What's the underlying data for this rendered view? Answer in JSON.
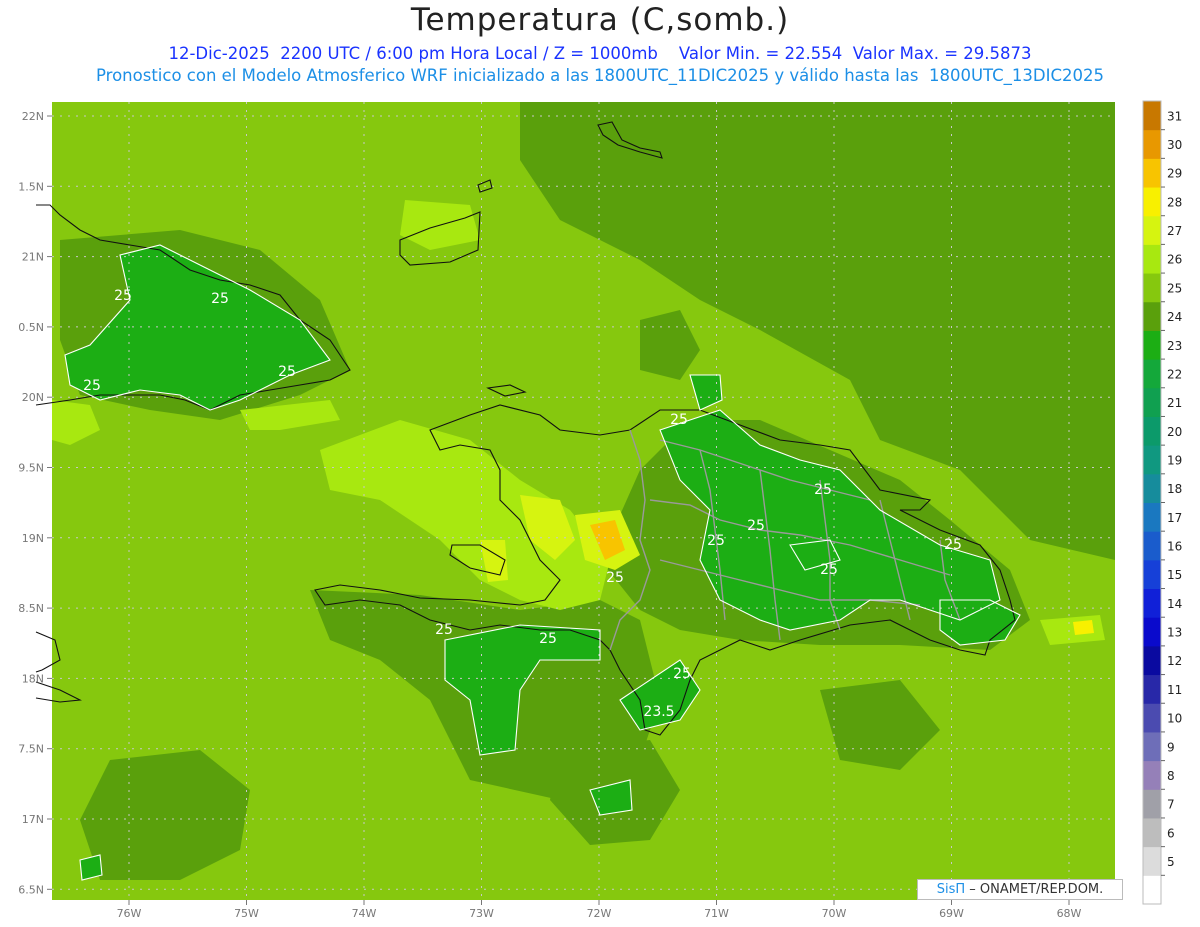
{
  "header": {
    "title": "Temperatura (C,somb.)",
    "subtitle_1": "12-Dic-2025  2200 UTC / 6:00 pm Hora Local / Z = 1000mb    Valor Min. = 22.554  Valor Max. = 29.5873",
    "subtitle_2": "Pronostico con el Modelo Atmosferico WRF inicializado a las 1800UTC_11DIC2025 y válido hasta las  1800UTC_13DIC2025"
  },
  "credit": {
    "sis": "SisΠ",
    "rest": " – ONAMET/REP.DOM."
  },
  "map": {
    "lat_labels": [
      "22N",
      "1.5N",
      "21N",
      "0.5N",
      "20N",
      "9.5N",
      "19N",
      "8.5N",
      "18N",
      "7.5N",
      "17N",
      "6.5N"
    ],
    "lon_labels": [
      "76W",
      "75W",
      "74W",
      "73W",
      "72W",
      "71W",
      "70W",
      "69W",
      "68W"
    ],
    "contour_labels": [
      "25",
      "25",
      "25",
      "25",
      "25",
      "25",
      "25",
      "25",
      "25",
      "25",
      "25",
      "25",
      "25",
      "25",
      "23.5"
    ]
  },
  "colorbar": {
    "levels": [
      "5",
      "6",
      "7",
      "8",
      "9",
      "10",
      "11",
      "12",
      "13",
      "14",
      "15",
      "16",
      "17",
      "18",
      "19",
      "20",
      "21",
      "22",
      "23",
      "24",
      "25",
      "26",
      "27",
      "28",
      "29",
      "30",
      "31"
    ],
    "colors": [
      "#ffffff",
      "#dcdcdc",
      "#bdbdbd",
      "#a0a0a8",
      "#9580b8",
      "#6e6eb8",
      "#4b4bb0",
      "#2828a8",
      "#0a0aa0",
      "#0a0acc",
      "#1020d8",
      "#1640d8",
      "#1a5ccc",
      "#1a78c0",
      "#168c9c",
      "#109880",
      "#0c9a6a",
      "#10a050",
      "#14a83a",
      "#1cae14",
      "#5aa00c",
      "#86c80e",
      "#a8e810",
      "#d6f410",
      "#f8f000",
      "#f8c400",
      "#e89800",
      "#c87800"
    ]
  }
}
